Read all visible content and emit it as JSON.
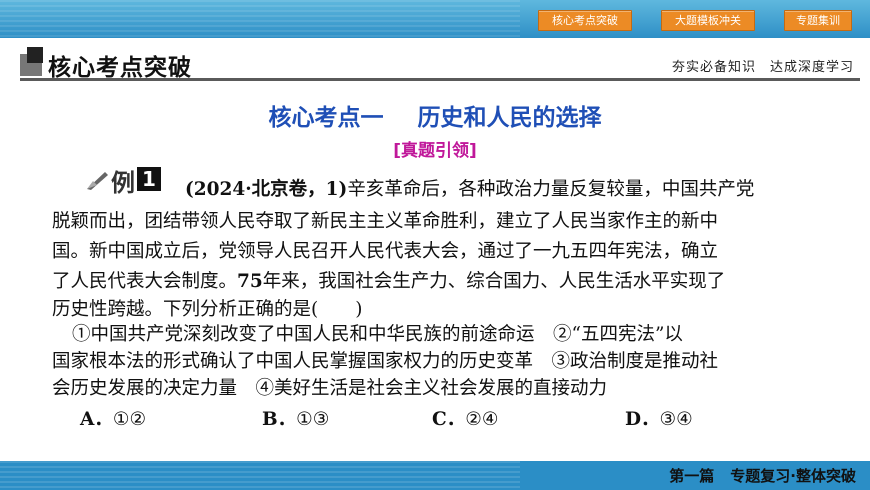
{
  "nav": {
    "btn1": "核心考点突破",
    "btn2": "大题模板冲关",
    "btn3": "专题集训"
  },
  "header": {
    "title": "核心考点突破",
    "tagline": "夯实必备知识　达成深度学习"
  },
  "section": {
    "title_part1": "核心考点一",
    "title_part2": "历史和人民的选择",
    "subtitle": "[真题引领]"
  },
  "example": {
    "label": "例",
    "number": "1",
    "source": "(2024·北京卷，1)",
    "lines": [
      "辛亥革命后，各种政治力量反复较量，中国共产党",
      "脱颖而出，团结带领人民夺取了新民主主义革命胜利，建立了人民当家作主的新中",
      "国。新中国成立后，党领导人民召开人民代表大会，通过了一九五四年宪法，确立",
      "了人民代表大会制度。",
      "75",
      "年来，我国社会生产力、综合国力、人民生活水平实现了",
      "历史性跨越。下列分析正确的是(　　)",
      "①中国共产党深刻改变了中国人民和中华民族的前途命运　②“五四宪法”以",
      "国家根本法的形式确认了中国人民掌握国家权力的历史变革　③政治制度是推动社",
      "会历史发展的决定力量　④美好生活是社会主义社会发展的直接动力"
    ],
    "options": [
      {
        "letter": "A．",
        "text": "①②"
      },
      {
        "letter": "B．",
        "text": "①③"
      },
      {
        "letter": "C．",
        "text": "②④"
      },
      {
        "letter": "D．",
        "text": "③④"
      }
    ]
  },
  "footer": {
    "part": "第一篇",
    "name": "专题复习·整体突破"
  },
  "colors": {
    "topbar": "#2e8fc6",
    "nav_button": "#ec8b25",
    "section_title": "#1f4fb6",
    "subtitle": "#c0189a",
    "footer": "#2b8ec6"
  }
}
